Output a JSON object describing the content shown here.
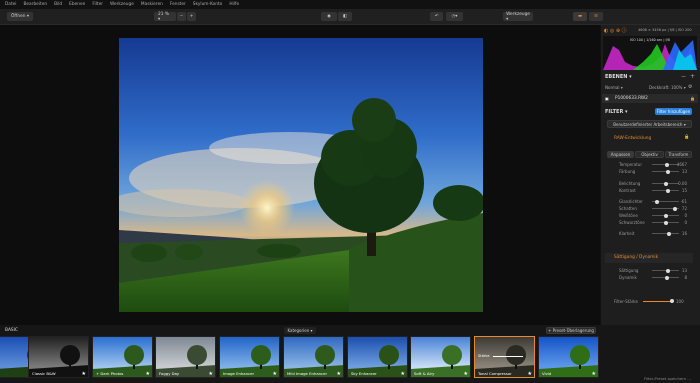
{
  "menu": [
    "Datei",
    "Bearbeiten",
    "Bild",
    "Ebenen",
    "Filter",
    "Werkzeuge",
    "Maskieren",
    "Fenster",
    "Skylum-Konto",
    "Hilfe"
  ],
  "toolbar": {
    "open": "Öffnen ▾",
    "zoom": "21 % ▾",
    "tools": "Werkzeuge ▾"
  },
  "histogram": {
    "info1": "4608 × 3456 px  |  f/8  |  ISO 200",
    "info2": "ISO 100  |  1/160 sec  |  f/8"
  },
  "layers": {
    "title": "EBENEN ▾",
    "mode": "Normal ▾",
    "opacity": "Deckkraft: 100% ▾",
    "file": "P1000633.RW2"
  },
  "filter": {
    "title": "FILTER ▾",
    "add": "Filter hinzufügen",
    "preset": "Benutzerdefinierter Arbeitsbereich ▾",
    "raw": "RAW-Entwicklung"
  },
  "tabs": [
    "Anpassen",
    "Objektiv",
    "Transform"
  ],
  "sliders": [
    {
      "label": "Temperatur",
      "value": "4667",
      "pos": 0.55
    },
    {
      "label": "Färbung",
      "value": "13",
      "pos": 0.6
    },
    {
      "label": "Belichtung",
      "value": "0.00",
      "pos": 0.5
    },
    {
      "label": "Kontrast",
      "value": "15",
      "pos": 0.6
    },
    {
      "label": "Glanzlichter",
      "value": "-61",
      "pos": 0.2
    },
    {
      "label": "Schatten",
      "value": "72",
      "pos": 0.85
    },
    {
      "label": "Weißtöne",
      "value": "0",
      "pos": 0.5
    },
    {
      "label": "Schwarztöne",
      "value": "0",
      "pos": 0.5
    },
    {
      "label": "Klarheit",
      "value": "16",
      "pos": 0.62
    }
  ],
  "saturation": {
    "title": "Sättigung / Dynamik",
    "rows": [
      {
        "label": "Sättigung",
        "value": "13",
        "pos": 0.6
      },
      {
        "label": "Dynamik",
        "value": "8",
        "pos": 0.56
      }
    ]
  },
  "strength": {
    "label": "Filter-Stärke",
    "value": "100"
  },
  "strip": {
    "category": "BASIC",
    "categories": "Kategorien ▾",
    "overlay": "+ Preset-Überlagerung",
    "save": "Filter-Preset speichern ...",
    "thumb_slider": "Stärke"
  },
  "thumbs": [
    "",
    "Classic B&W",
    "+ Dark Photos",
    "Foggy Day",
    "Image Enhancer",
    "Mild Image Enhancer",
    "Sky Enhancer",
    "Soft & Airy",
    "Tonal Compressor",
    "Vivid"
  ]
}
